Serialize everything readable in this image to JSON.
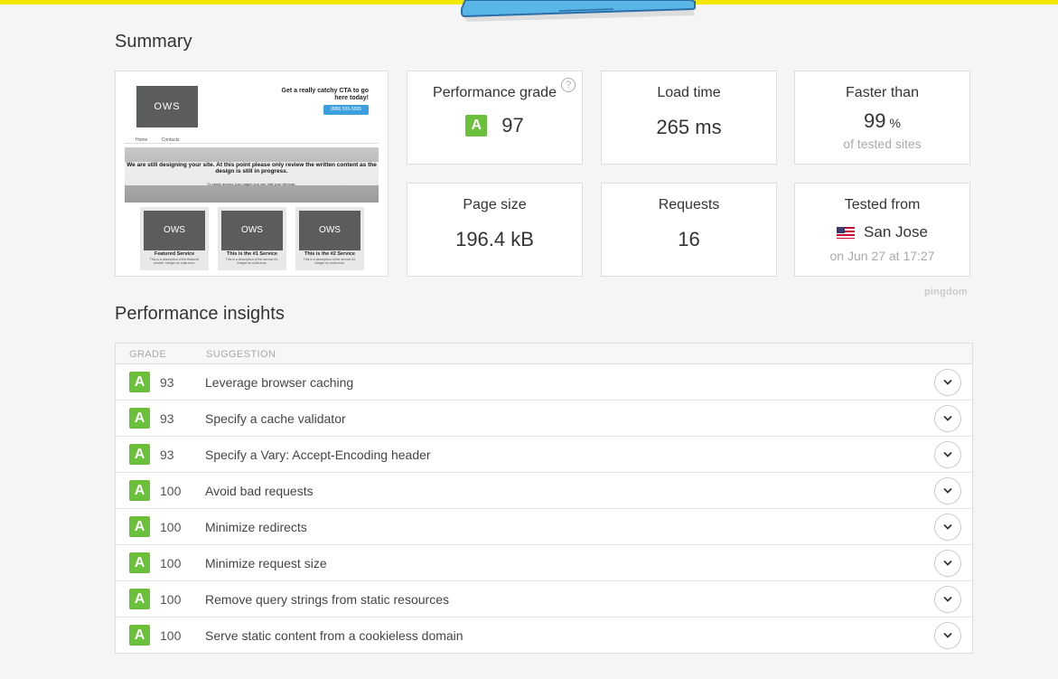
{
  "summary_title": "Summary",
  "insights_title": "Performance insights",
  "preview": {
    "logo": "OWS",
    "cta": "Get a really catchy CTA to go here today!",
    "cta_button": "(888) 555-5555",
    "nav": [
      "Home",
      "Contacts"
    ],
    "hero_text": "We are still designing your site. At this point please only review the written content as the design is still in progress.",
    "hero_sub": "To easily access your pages you can visit your sitemap.",
    "services": [
      {
        "title": "Featured Service",
        "desc": "This is a description of the featured service. Integer eu nulla eros."
      },
      {
        "title": "This is the #1 Service",
        "desc": "This is a description of the service #1. Integer eu nulla eros."
      },
      {
        "title": "This is the #2 Service",
        "desc": "This is a description of the service #2. Integer eu nulla eros."
      }
    ]
  },
  "metrics": {
    "grade": {
      "label": "Performance grade",
      "letter": "A",
      "value": "97",
      "help": "?"
    },
    "load_time": {
      "label": "Load time",
      "value": "265 ms"
    },
    "faster_than": {
      "label": "Faster than",
      "value": "99",
      "unit": "%",
      "sub": "of tested sites"
    },
    "page_size": {
      "label": "Page size",
      "value": "196.4 kB"
    },
    "requests": {
      "label": "Requests",
      "value": "16"
    },
    "tested_from": {
      "label": "Tested from",
      "location": "San Jose",
      "sub": "on Jun 27 at 17:27"
    }
  },
  "brand": "pingdom",
  "table": {
    "headers": {
      "grade": "GRADE",
      "suggestion": "SUGGESTION"
    },
    "rows": [
      {
        "letter": "A",
        "score": "93",
        "suggestion": "Leverage browser caching"
      },
      {
        "letter": "A",
        "score": "93",
        "suggestion": "Specify a cache validator"
      },
      {
        "letter": "A",
        "score": "93",
        "suggestion": "Specify a Vary: Accept-Encoding header"
      },
      {
        "letter": "A",
        "score": "100",
        "suggestion": "Avoid bad requests"
      },
      {
        "letter": "A",
        "score": "100",
        "suggestion": "Minimize redirects"
      },
      {
        "letter": "A",
        "score": "100",
        "suggestion": "Minimize request size"
      },
      {
        "letter": "A",
        "score": "100",
        "suggestion": "Remove query strings from static resources"
      },
      {
        "letter": "A",
        "score": "100",
        "suggestion": "Serve static content from a cookieless domain"
      }
    ]
  },
  "colors": {
    "accent_yellow": "#f3e600",
    "grade_green": "#6abf3b",
    "laptop_blue": "#5bb6e8"
  }
}
